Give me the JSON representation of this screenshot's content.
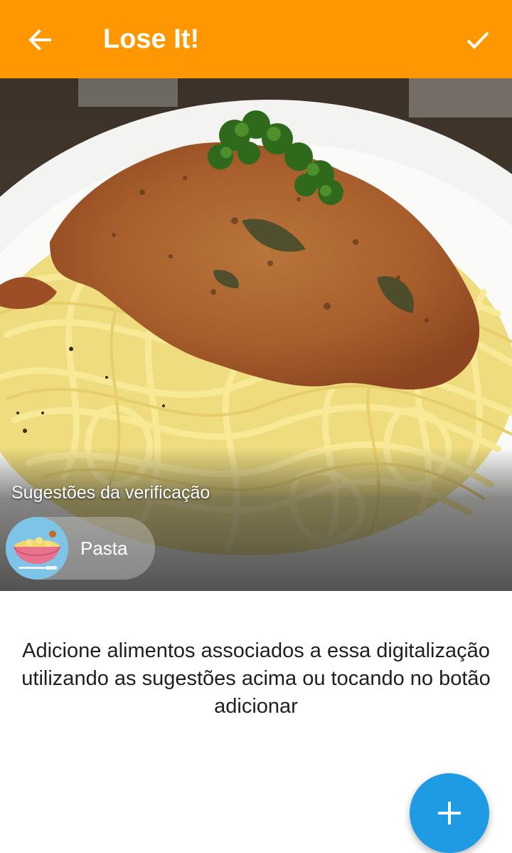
{
  "app_bar": {
    "title": "Lose It!",
    "back_icon": "arrow-left-icon",
    "confirm_icon": "check-icon",
    "color": "#FF9800"
  },
  "photo": {
    "suggestions_label": "Sugestões da verificação",
    "suggestions": [
      {
        "label": "Pasta",
        "icon": "pasta-bowl-icon"
      }
    ]
  },
  "hint": {
    "text": "Adicione alimentos associados a essa digitalização utilizando as sugestões acima ou tocando no botão adicionar"
  },
  "fab": {
    "icon": "plus-icon",
    "color": "#1E9BE2"
  }
}
